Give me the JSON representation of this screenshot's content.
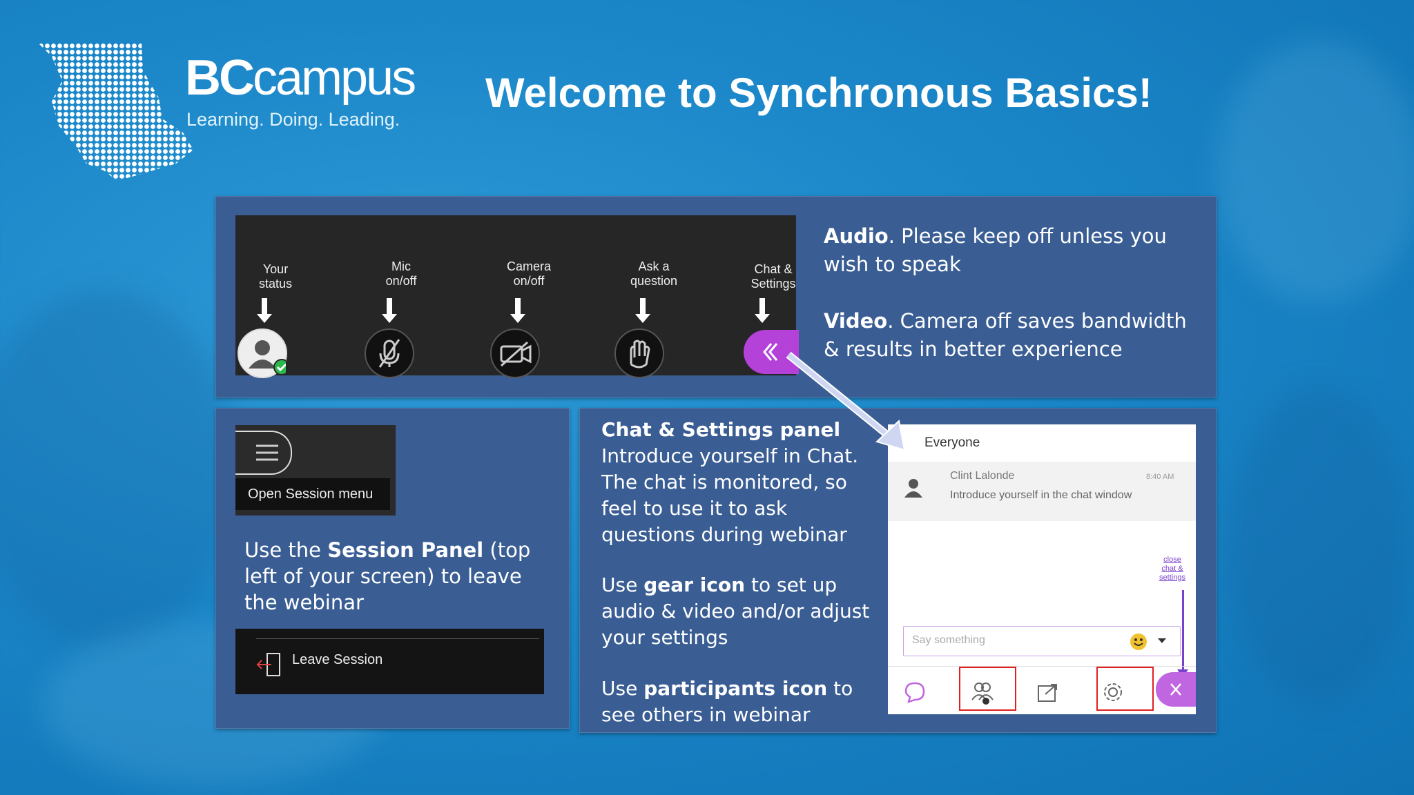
{
  "logo": {
    "word_bold": "BC",
    "word_rest": "campus",
    "tagline": "Learning. Doing. Leading."
  },
  "title": "Welcome to Synchronous Basics!",
  "toolbar": {
    "items": [
      {
        "label_1": "Your",
        "label_2": "status",
        "icon": "user-status-icon"
      },
      {
        "label_1": "Mic",
        "label_2": "on/off",
        "icon": "mic-off-icon"
      },
      {
        "label_1": "Camera",
        "label_2": "on/off",
        "icon": "camera-off-icon"
      },
      {
        "label_1": "Ask a",
        "label_2": "question",
        "icon": "raise-hand-icon"
      },
      {
        "label_1": "Chat &",
        "label_2": "Settings",
        "icon": "chevron-left-icon"
      }
    ]
  },
  "audio": {
    "heading": "Audio",
    "text": ". Please keep off unless you wish to speak"
  },
  "video": {
    "heading": "Video",
    "text": ". Camera off saves bandwidth & results in better experience"
  },
  "session": {
    "menu_label": "Open Session menu",
    "text_1": "Use the ",
    "bold": "Session Panel",
    "text_2": " (top left of your screen) to leave the webinar",
    "leave_label": "Leave Session"
  },
  "chat_settings": {
    "heading": "Chat & Settings panel",
    "intro": "Introduce yourself in Chat. The chat is monitored, so feel to use it to ask questions during webinar",
    "gear_1": "Use ",
    "gear_bold": "gear icon",
    "gear_2": " to set up audio & video and/or adjust your settings",
    "part_1": "Use ",
    "part_bold": "participants icon",
    "part_2": " to see others in webinar"
  },
  "chat_panel": {
    "channel": "Everyone",
    "sender": "Clint Lalonde",
    "time": "8:40 AM",
    "message": "Introduce yourself in the chat window",
    "close_note_1": "close",
    "close_note_2": "chat &",
    "close_note_3": "settings",
    "input_placeholder": "Say something"
  },
  "colors": {
    "accent_purple": "#b542d8",
    "highlight_red": "#e02020",
    "panel_blue": "#3a5e94"
  }
}
